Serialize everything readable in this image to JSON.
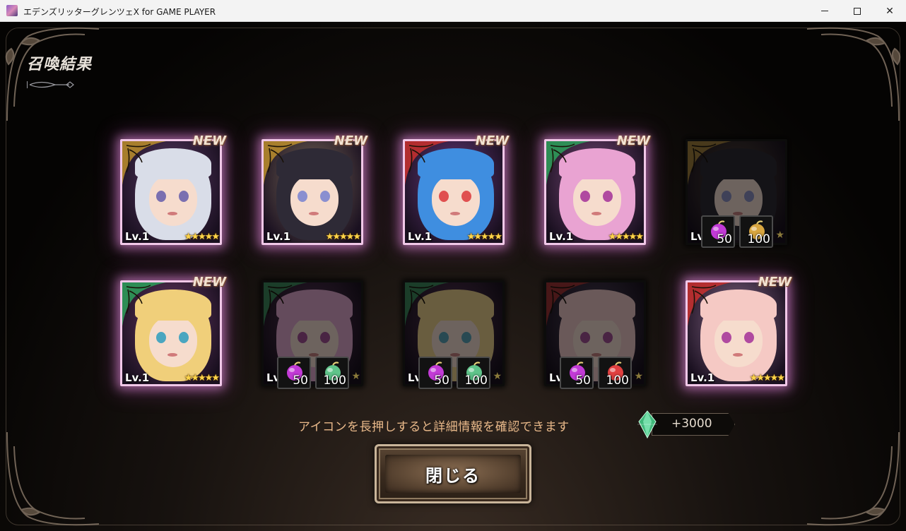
{
  "window": {
    "title": "エデンズリッターグレンツェX for GAME PLAYER",
    "min_label": "—",
    "close_label": "✕"
  },
  "screen": {
    "title": "召喚結果",
    "hint": "アイコンを長押しすると詳細情報を確認できます",
    "crystal_amount": "+3000",
    "close_button": "閉じる"
  },
  "cards": [
    {
      "new": "NEW",
      "lv": "Lv.1",
      "stars": "★★★★★",
      "hair": "#d9dde8",
      "bg": "#5a3a66",
      "corner": "#b68a2e",
      "eye": "#7a6fb0"
    },
    {
      "new": "NEW",
      "lv": "Lv.1",
      "stars": "★★★★★",
      "hair": "#2e2a36",
      "bg": "#7a6a5a",
      "corner": "#b68a2e",
      "eye": "#8a8fd0"
    },
    {
      "new": "NEW",
      "lv": "Lv.1",
      "stars": "★★★★★",
      "hair": "#3f8ee0",
      "bg": "#6a3a80",
      "corner": "#c23030",
      "eye": "#e05050"
    },
    {
      "new": "NEW",
      "lv": "Lv.1",
      "stars": "★★★★★",
      "hair": "#e9a3d2",
      "bg": "#7a4a7a",
      "corner": "#2f9a5a",
      "eye": "#b04aa0"
    },
    {
      "lv": "Lv",
      "reward_a": "50",
      "reward_b": "100",
      "hair": "#2e2a36",
      "bg": "#5a4a3a",
      "corner": "#b68a2e",
      "eye": "#8a8fd0",
      "gem_b": "#d8a640"
    },
    {
      "new": "NEW",
      "lv": "Lv.1",
      "stars": "★★★★★",
      "hair": "#f0cf7a",
      "bg": "#6a3a66",
      "corner": "#2f9a5a",
      "eye": "#4aa6c0"
    },
    {
      "lv": "Lv",
      "reward_a": "50",
      "reward_b": "100",
      "hair": "#e9a3d2",
      "bg": "#6a3a6a",
      "corner": "#2f9a5a",
      "eye": "#b04aa0",
      "gem_b": "#5fc48a"
    },
    {
      "lv": "Lv",
      "reward_a": "50",
      "reward_b": "100",
      "hair": "#f0cf7a",
      "bg": "#6a3a66",
      "corner": "#2f9a5a",
      "eye": "#4aa6c0",
      "gem_b": "#5fc48a"
    },
    {
      "lv": "Lv",
      "reward_a": "50",
      "reward_b": "100",
      "hair": "#f2c3c3",
      "bg": "#5a4a6a",
      "corner": "#c23030",
      "eye": "#b04aa0",
      "gem_b": "#e04040"
    },
    {
      "new": "NEW",
      "lv": "Lv.1",
      "stars": "★★★★★",
      "hair": "#f5c9c4",
      "bg": "#8a6a8a",
      "corner": "#c23030",
      "eye": "#b04aa0"
    }
  ],
  "colors": {
    "new_glow": "#f1c8e8",
    "hint_text": "#e9b98a",
    "crystal": "#5fd49a",
    "gem_a": "#c23ad6"
  }
}
